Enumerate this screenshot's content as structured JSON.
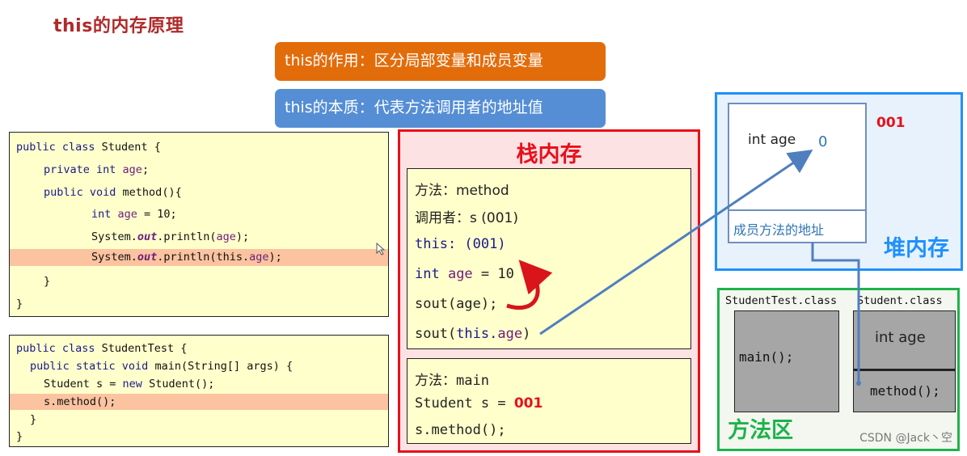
{
  "title": "this的内存原理",
  "callouts": {
    "purpose": "this的作用：区分局部变量和成员变量",
    "essence": "this的本质：代表方法调用者的地址值"
  },
  "code_student": {
    "lines": [
      {
        "parts": [
          "public class ",
          "",
          "Student {"
        ]
      },
      {
        "parts": [
          "private int ",
          "age",
          ";"
        ]
      },
      {
        "parts": [
          "public void ",
          "",
          "method(){"
        ]
      },
      {
        "parts": [
          "int ",
          "age",
          " = 10;"
        ]
      },
      {
        "parts": [
          "System.",
          "out",
          ".println(",
          "age",
          ");"
        ]
      },
      {
        "parts": [
          "System.",
          "out",
          ".println(this.",
          "age",
          ");"
        ]
      },
      {
        "parts": [
          "}"
        ]
      },
      {
        "parts": [
          "}"
        ]
      }
    ],
    "highlighted_line": 6
  },
  "code_student_test": {
    "lines": [
      {
        "parts": [
          "public class ",
          "StudentTest {"
        ]
      },
      {
        "parts": [
          "public static void ",
          "main(String[] args) {"
        ]
      },
      {
        "parts": [
          "Student s = ",
          "new ",
          "Student();"
        ]
      },
      {
        "parts": [
          "s.method();"
        ]
      },
      {
        "parts": [
          "}"
        ]
      },
      {
        "parts": [
          "}"
        ]
      }
    ],
    "highlighted_line": 4
  },
  "stack": {
    "title": "栈内存",
    "method_frame": {
      "method_label": "方法：method",
      "caller_label": "调用者：s (001)",
      "this_label": "this: ",
      "this_value": "(001)",
      "line_int_kw": "int ",
      "line_int_var": "age",
      "line_int_rest": " = 10",
      "sout_age": "sout(age);",
      "sout_this_a": "sout(",
      "sout_this_b": "this.",
      "sout_this_c": "age",
      "sout_this_d": ")"
    },
    "main_frame": {
      "method_label": "方法：main",
      "student_s": "Student s = ",
      "address": "001",
      "call": "s.method();"
    }
  },
  "heap": {
    "title": "堆内存",
    "address": "001",
    "field_label": "int age",
    "field_value": "0",
    "method_ref_label": "成员方法的地址"
  },
  "method_area": {
    "title": "方法区",
    "classes": [
      {
        "name": "StudentTest.class",
        "members": [
          "main();"
        ]
      },
      {
        "name": "Student.class",
        "members": [
          "int age",
          "method();"
        ]
      }
    ]
  },
  "watermark": "CSDN @Jack丶空",
  "colors": {
    "title_red": "#b02a2a",
    "orange": "#e36c0a",
    "blue": "#558ed5",
    "stack_red": "#e8101a",
    "heap_blue": "#1e90ff",
    "method_area_green": "#1db34a",
    "arrow_blue": "#4f7fbf",
    "address_red": "#e8101a"
  }
}
